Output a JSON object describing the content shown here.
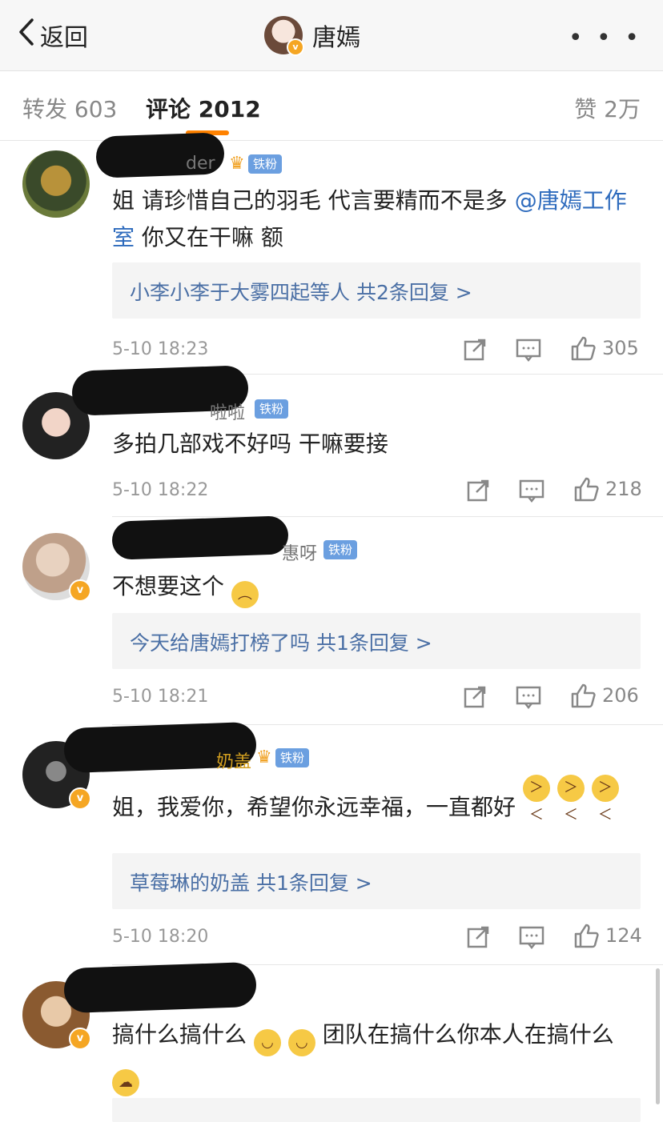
{
  "header": {
    "back_label": "返回",
    "title": "唐嫣",
    "more_label": "• • •",
    "verified_glyph": "v"
  },
  "tabs": {
    "repost": "转发 603",
    "comment": "评论 2012",
    "like": "赞 2万"
  },
  "comments": [
    {
      "username": "",
      "name_tail": "der",
      "badge": "铁粉",
      "text": "姐 请珍惜自己的羽毛 代言要精而不是多 ",
      "mention": "@唐嫣工作室",
      "text_after": " 你又在干嘛 额",
      "reply": "小李小李于大雾四起等人  共2条回复 >",
      "time": "5-10 18:23",
      "likes": "305"
    },
    {
      "username": "",
      "name_tail": "啦啦",
      "badge": "铁粉",
      "text": "多拍几部戏不好吗 干嘛要接",
      "time": "5-10 18:22",
      "likes": "218"
    },
    {
      "username": "",
      "name_tail": "惠呀",
      "badge": "铁粉",
      "text": "不想要这个",
      "reply": "今天给唐嫣打榜了吗  共1条回复 >",
      "time": "5-10 18:21",
      "likes": "206"
    },
    {
      "username": "",
      "name_tail": "奶盖",
      "badge": "铁粉",
      "text": "姐，我爱你，希望你永远幸福，一直都好",
      "reply": "草莓琳的奶盖  共1条回复 >",
      "time": "5-10 18:20",
      "likes": "124"
    },
    {
      "username": "",
      "text": "搞什么搞什么",
      "text_mid": "团队在搞什么你本人在搞什么"
    }
  ]
}
